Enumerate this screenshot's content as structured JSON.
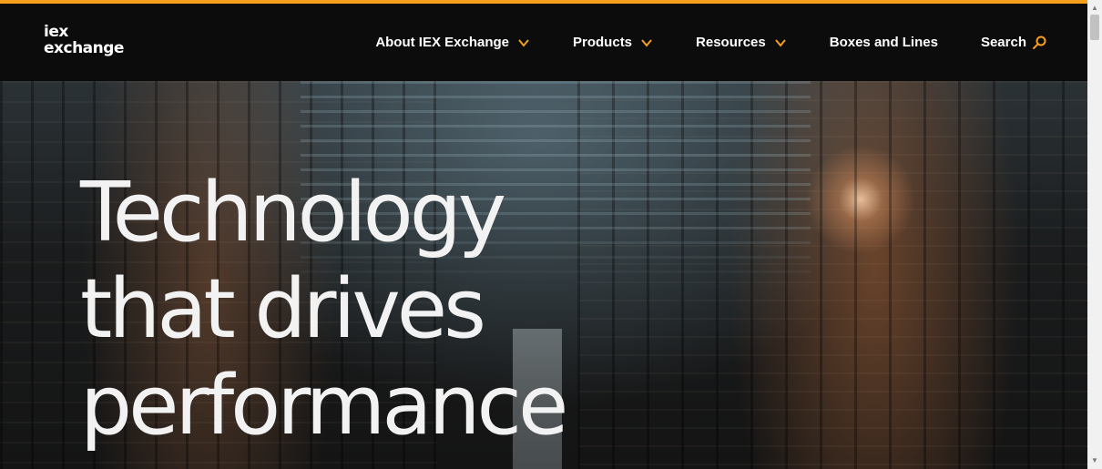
{
  "brand": {
    "logo_line1": "iex",
    "logo_line2": "exchange",
    "accent_color": "#f7a01d"
  },
  "nav": {
    "items": [
      {
        "label": "About IEX Exchange",
        "has_dropdown": true
      },
      {
        "label": "Products",
        "has_dropdown": true
      },
      {
        "label": "Resources",
        "has_dropdown": true
      },
      {
        "label": "Boxes and Lines",
        "has_dropdown": false
      },
      {
        "label": "Search",
        "icon": "search-icon"
      }
    ]
  },
  "hero": {
    "title_lines": [
      "Technology",
      "that drives",
      "performance"
    ]
  }
}
